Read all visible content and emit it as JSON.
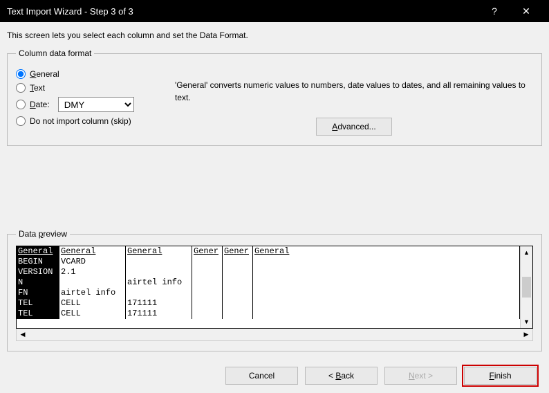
{
  "title": "Text Import Wizard - Step 3 of 3",
  "intro": "This screen lets you select each column and set the Data Format.",
  "fieldset_label": "Column data format",
  "radios": {
    "general": "General",
    "text": "Text",
    "date": "Date:",
    "skip": "Do not import column (skip)"
  },
  "date_format": "DMY",
  "description": "'General' converts numeric values to numbers, date values to dates, and all remaining values to text.",
  "advanced": "Advanced...",
  "preview_label": "Data preview",
  "headers": [
    "General",
    "General",
    "General",
    "Gener",
    "Gener",
    "General"
  ],
  "rows": [
    [
      "BEGIN",
      "VCARD",
      "",
      "",
      "",
      ""
    ],
    [
      "VERSION",
      "2.1",
      "",
      "",
      "",
      ""
    ],
    [
      "N",
      "",
      "airtel info",
      "",
      "",
      ""
    ],
    [
      "FN",
      "airtel info",
      "",
      "",
      "",
      ""
    ],
    [
      "TEL",
      "CELL",
      "171111",
      "",
      "",
      ""
    ],
    [
      "TEL",
      "CELL",
      "171111",
      "",
      "",
      ""
    ]
  ],
  "buttons": {
    "cancel": "Cancel",
    "back": "< Back",
    "next": "Next >",
    "finish": "Finish"
  }
}
